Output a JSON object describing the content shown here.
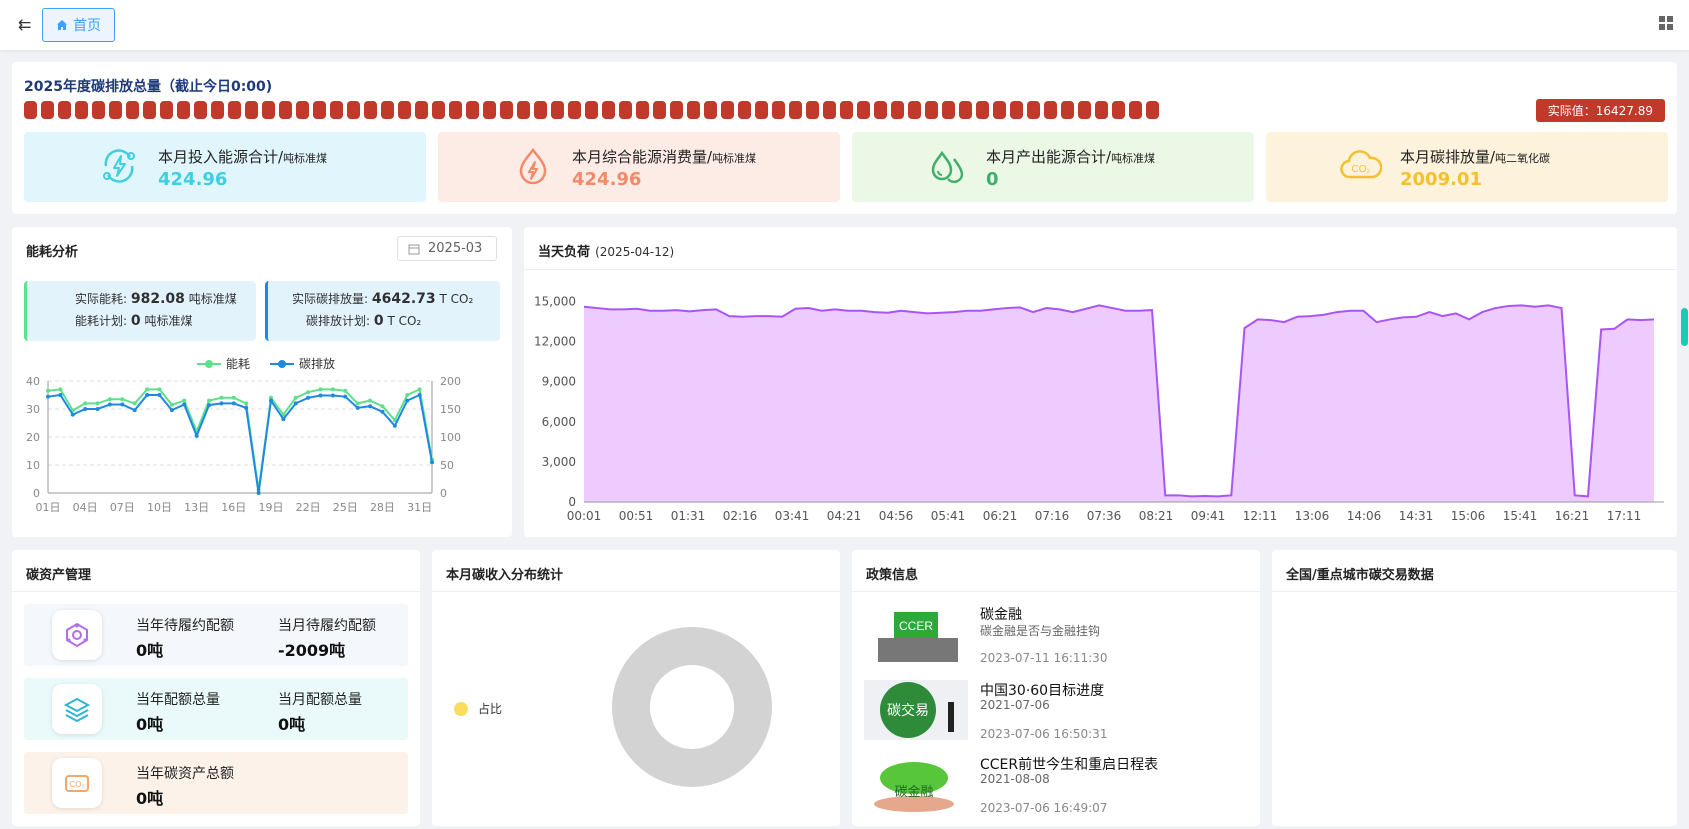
{
  "topbar": {
    "home_tab": "首页"
  },
  "summary": {
    "title": "2025年度碳排放总量（截止今日0:00)",
    "actual_badge": "实际值：16427.89",
    "stats": [
      {
        "label": "本月投入能源合计/",
        "unit": "吨标准煤",
        "value": "424.96",
        "icon": "lightning-cycle-icon",
        "bg": "#e0f6fc",
        "color": "#3ecfe0"
      },
      {
        "label": "本月综合能源消费量/",
        "unit": "吨标准煤",
        "value": "424.96",
        "icon": "flame-drop-icon",
        "bg": "#fdece6",
        "color": "#f08a68"
      },
      {
        "label": "本月产出能源合计/",
        "unit": "吨标准煤",
        "value": "0",
        "icon": "water-drops-icon",
        "bg": "#ecf8e6",
        "color": "#3fae6a"
      },
      {
        "label": "本月碳排放量/",
        "unit": "吨二氧化碳",
        "value": "2009.01",
        "icon": "co2-cloud-icon",
        "bg": "#fdf3dc",
        "color": "#f4c030"
      }
    ]
  },
  "energy": {
    "title": "能耗分析",
    "date": "2025-03",
    "actual_energy_label": "实际能耗:",
    "actual_energy_value": "982.08",
    "actual_energy_unit": "吨标准煤",
    "energy_plan_label": "能耗计划:",
    "energy_plan_value": "0",
    "energy_plan_unit": "吨标准煤",
    "actual_carbon_label": "实际碳排放量:",
    "actual_carbon_value": "4642.73",
    "actual_carbon_unit": "T CO₂",
    "carbon_plan_label": "碳排放计划:",
    "carbon_plan_value": "0",
    "carbon_plan_unit": "T CO₂"
  },
  "load": {
    "title": "当天负荷",
    "date": "(2025-04-12)"
  },
  "assets": {
    "title": "碳资产管理",
    "rows": [
      {
        "icon": "target-icon",
        "bg": "#f4f8fc",
        "items": [
          {
            "label": "当年待履约配额",
            "value": "0吨"
          },
          {
            "label": "当月待履约配额",
            "value": "-2009吨"
          }
        ]
      },
      {
        "icon": "layers-icon",
        "bg": "#eafafb",
        "items": [
          {
            "label": "当年配额总量",
            "value": "0吨"
          },
          {
            "label": "当月配额总量",
            "value": "0吨"
          }
        ]
      },
      {
        "icon": "co2-box-icon",
        "bg": "#fdf2ea",
        "items": [
          {
            "label": "当年碳资产总额",
            "value": "0吨"
          }
        ]
      }
    ]
  },
  "income": {
    "title": "本月碳收入分布统计",
    "legend": "占比"
  },
  "policy": {
    "title": "政策信息",
    "items": [
      {
        "title": "碳金融",
        "subtitle": "碳金融是否与金融挂钩",
        "date": "2023-07-11 16:11:30",
        "thumb_text": "CCER"
      },
      {
        "title": "中国30·60目标进度",
        "subtitle": "2021-07-06",
        "date": "2023-07-06 16:50:31",
        "thumb_text": "碳交易"
      },
      {
        "title": "CCER前世今生和重启日程表",
        "subtitle": "2021-08-08",
        "date": "2023-07-06 16:49:07",
        "thumb_text": "碳金融"
      }
    ]
  },
  "trade": {
    "title": "全国/重点城市碳交易数据"
  },
  "chart_data": [
    {
      "type": "line",
      "legend_position": "top-center",
      "categories": [
        "01日",
        "02日",
        "03日",
        "04日",
        "05日",
        "06日",
        "07日",
        "08日",
        "09日",
        "10日",
        "11日",
        "12日",
        "13日",
        "14日",
        "15日",
        "16日",
        "17日",
        "18日",
        "19日",
        "20日",
        "21日",
        "22日",
        "23日",
        "24日",
        "25日",
        "26日",
        "27日",
        "28日",
        "29日",
        "30日",
        "31日"
      ],
      "x_tick_labels": [
        "01日",
        "04日",
        "07日",
        "10日",
        "13日",
        "16日",
        "19日",
        "22日",
        "25日",
        "28日",
        "31日"
      ],
      "series": [
        {
          "name": "能耗",
          "axis": "left",
          "color": "#5ee08a",
          "values": [
            36.5,
            37,
            29.5,
            32,
            32,
            33.5,
            33.5,
            32,
            37,
            37,
            31.5,
            33,
            22,
            33,
            34,
            34,
            32,
            1,
            34,
            28,
            34,
            36,
            37,
            37,
            36.5,
            32,
            33,
            31,
            26,
            35,
            37,
            12
          ]
        },
        {
          "name": "碳排放",
          "axis": "right",
          "color": "#1e88e5",
          "values": [
            172,
            175,
            140,
            150,
            150,
            158,
            158,
            148,
            175,
            175,
            148,
            158,
            102,
            157,
            160,
            160,
            152,
            0,
            165,
            132,
            160,
            170,
            174,
            174,
            172,
            152,
            155,
            145,
            120,
            165,
            175,
            55
          ]
        }
      ],
      "y_left": {
        "min": 0,
        "max": 40,
        "ticks": [
          0,
          10,
          20,
          30,
          40
        ]
      },
      "y_right": {
        "min": 0,
        "max": 200,
        "ticks": [
          0,
          50,
          100,
          150,
          200
        ]
      },
      "grid": true
    },
    {
      "type": "area",
      "color": "#a855f7",
      "fill": "#eecbff",
      "x_tick_labels": [
        "00:01",
        "00:51",
        "01:31",
        "02:16",
        "03:41",
        "04:21",
        "04:56",
        "05:41",
        "06:21",
        "07:16",
        "07:36",
        "08:21",
        "09:41",
        "12:11",
        "13:06",
        "14:06",
        "14:31",
        "15:06",
        "15:41",
        "16:21",
        "17:11"
      ],
      "y_ticks": [
        0,
        3000,
        6000,
        9000,
        12000,
        15000
      ],
      "ylim": [
        0,
        16000
      ],
      "values": [
        14600,
        14500,
        14400,
        14400,
        14450,
        14300,
        14300,
        14350,
        14250,
        14350,
        14400,
        13900,
        13850,
        13900,
        13900,
        13850,
        14450,
        14500,
        14300,
        14400,
        14300,
        14300,
        14200,
        14150,
        14300,
        14200,
        14100,
        14150,
        14200,
        14300,
        14300,
        14400,
        14500,
        14550,
        14200,
        14500,
        14400,
        14200,
        14450,
        14700,
        14500,
        14300,
        14300,
        14350,
        500,
        500,
        420,
        450,
        420,
        500,
        13000,
        13650,
        13600,
        13450,
        13850,
        13900,
        14000,
        14200,
        14300,
        14300,
        13450,
        13650,
        13800,
        13850,
        14200,
        13900,
        14100,
        13650,
        14200,
        14500,
        14650,
        14700,
        14600,
        14700,
        14500,
        500,
        420,
        12900,
        12950,
        13650,
        13600,
        13650
      ]
    },
    {
      "type": "pie",
      "legend": [
        "占比"
      ],
      "values": [
        0
      ],
      "legend_position": "left"
    }
  ]
}
